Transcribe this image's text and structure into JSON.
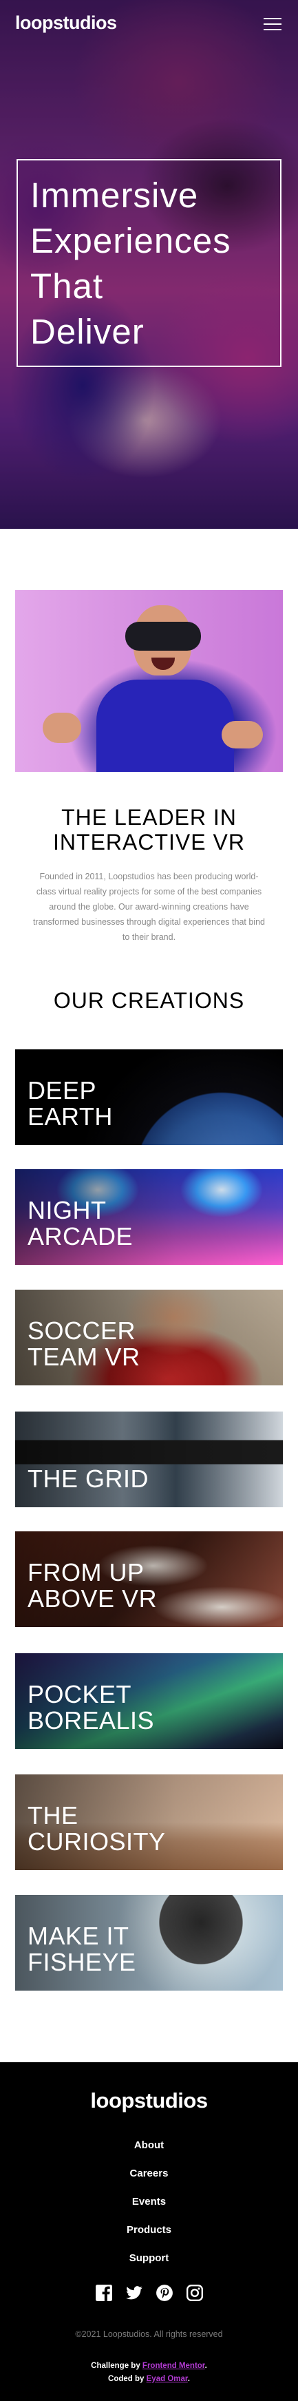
{
  "header": {
    "logo": "loopstudios",
    "menu_icon": "hamburger-icon"
  },
  "hero": {
    "title": "Immersive\nExperiences\nThat\nDeliver"
  },
  "interactive": {
    "title": "THE LEADER IN\nINTERACTIVE VR",
    "text": "Founded in 2011, Loopstudios has been producing world-class virtual reality projects for some of the best companies around the globe. Our award-winning creations have transformed businesses through digital experiences that bind to their brand."
  },
  "creations": {
    "title": "OUR CREATIONS",
    "items": [
      {
        "title": "DEEP\nEARTH"
      },
      {
        "title": "NIGHT\nARCADE"
      },
      {
        "title": "SOCCER\nTEAM VR"
      },
      {
        "title": "THE GRID"
      },
      {
        "title": "FROM UP\nABOVE VR"
      },
      {
        "title": "POCKET\nBOREALIS"
      },
      {
        "title": "THE\nCURIOSITY"
      },
      {
        "title": "MAKE IT\nFISHEYE"
      }
    ]
  },
  "footer": {
    "logo": "loopstudios",
    "nav": [
      "About",
      "Careers",
      "Events",
      "Products",
      "Support"
    ],
    "socials": [
      "facebook-icon",
      "twitter-icon",
      "pinterest-icon",
      "instagram-icon"
    ],
    "copyright": "©2021 Loopstudios. All rights reserved",
    "challenge_prefix": "Challenge by",
    "challenge_link": "Frontend Mentor",
    "coded_prefix": "Coded by",
    "coded_link": "Eyad Omar"
  },
  "colors": {
    "accent": "#b23bd1",
    "footer_bg": "#000000",
    "muted_text": "#8a8a8a"
  }
}
